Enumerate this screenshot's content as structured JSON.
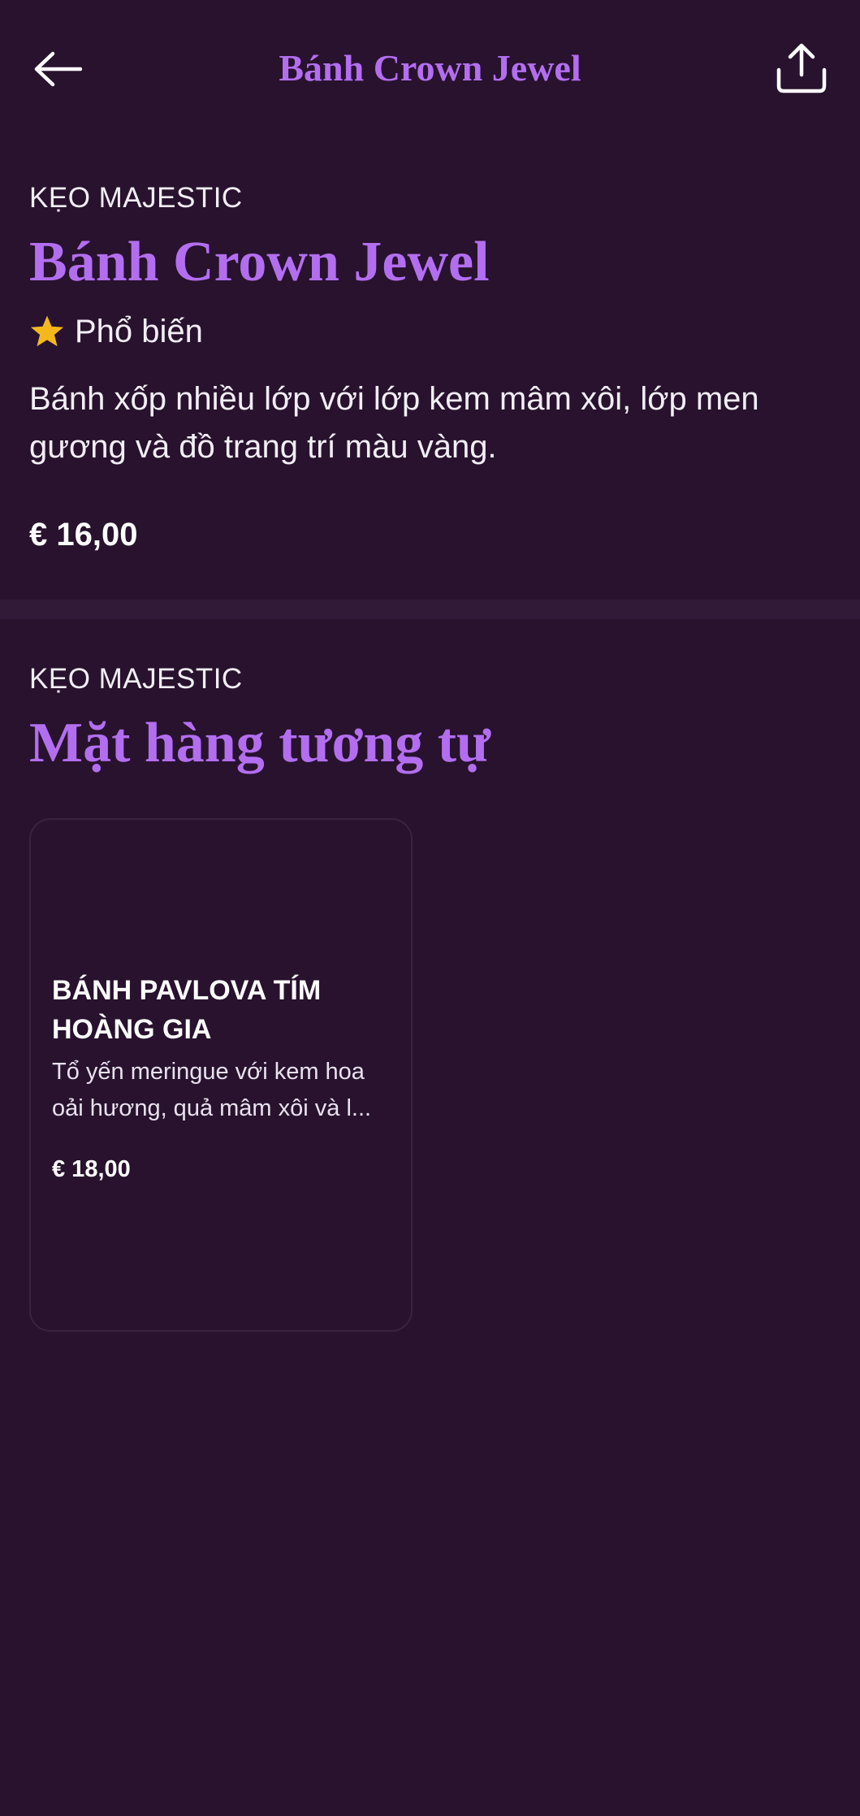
{
  "header": {
    "title": "Bánh Crown Jewel"
  },
  "product": {
    "brand": "KẸO MAJESTIC",
    "name": "Bánh Crown Jewel",
    "badge": "Phổ biến",
    "description": "Bánh xốp nhiều lớp với lớp kem mâm xôi, lớp men gương và đồ trang trí màu vàng.",
    "price": "€ 16,00"
  },
  "similar": {
    "brand": "KẸO MAJESTIC",
    "heading": "Mặt hàng tương tự",
    "items": [
      {
        "name": "BÁNH PAVLOVA TÍM HOÀNG GIA",
        "description": "Tổ yến meringue với kem hoa oải hương, quả mâm xôi và l...",
        "price": "€ 18,00"
      }
    ]
  },
  "icons": {
    "back": "arrow-left-icon",
    "share": "share-upload-icon",
    "badge": "star-icon"
  },
  "colors": {
    "background": "#28122e",
    "accent": "#b36ef0",
    "star": "#f5b81c",
    "divider": "#311a37"
  }
}
